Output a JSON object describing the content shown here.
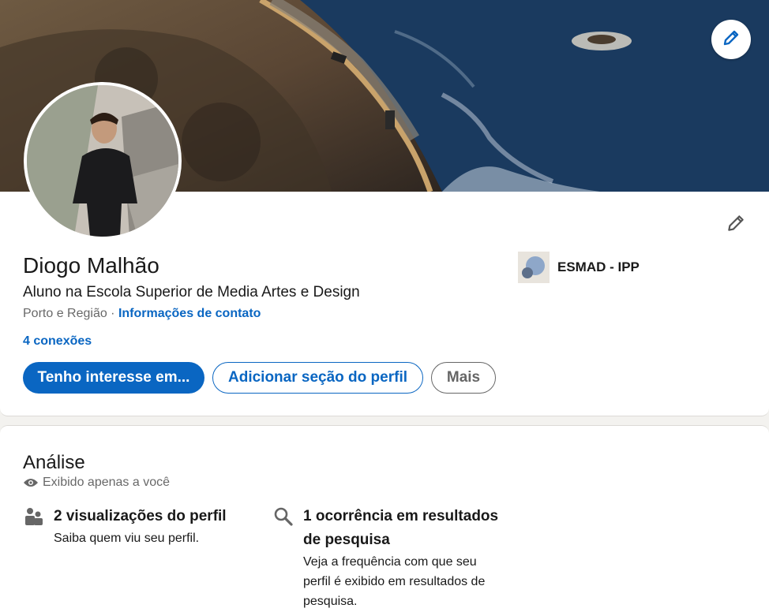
{
  "profile": {
    "name": "Diogo Malhão",
    "headline": "Aluno na Escola Superior de Media Artes e Design",
    "location": "Porto e Região",
    "location_separator": " · ",
    "contact_link": "Informações de contato",
    "connections": "4 conexões",
    "education": "ESMAD - IPP"
  },
  "actions": {
    "primary": "Tenho interesse em...",
    "add_section": "Adicionar seção do perfil",
    "more": "Mais"
  },
  "icons": {
    "cover_edit": "pencil-icon",
    "intro_edit": "pencil-icon",
    "private": "eye-icon",
    "profile_views": "people-icon",
    "search_appearances": "search-icon"
  },
  "analytics": {
    "title": "Análise",
    "private_note": "Exibido apenas a você",
    "stats": [
      {
        "title": "2 visualizações do perfil",
        "desc": "Saiba quem viu seu perfil."
      },
      {
        "title": "1 ocorrência em resultados de pesquisa",
        "desc": "Veja a frequência com que seu perfil é exibido em resultados de pesquisa."
      }
    ]
  },
  "colors": {
    "accent": "#0a66c2",
    "background": "#f3f2ef",
    "card": "#ffffff"
  }
}
